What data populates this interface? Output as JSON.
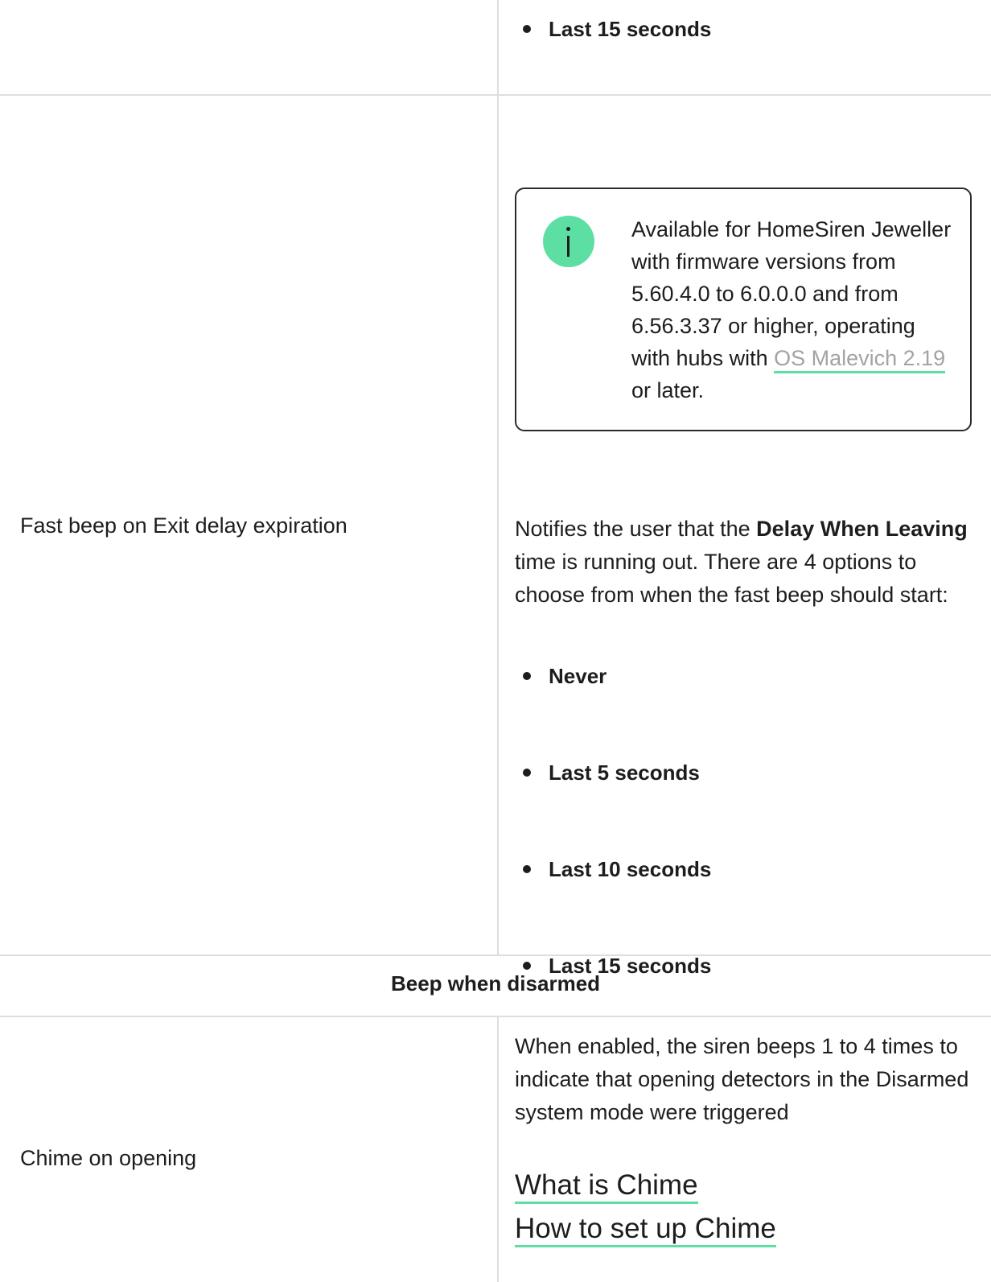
{
  "row_top": {
    "bullets": [
      "Last 15 seconds"
    ]
  },
  "row_fast_beep": {
    "label": "Fast beep on Exit delay expiration",
    "note": {
      "text_before_link": "Available for HomeSiren Jeweller with firmware versions from 5.60.4.0 to 6.0.0.0 and from 6.56.3.37 or higher, operating with hubs with ",
      "link_text": "OS Malevich 2.19",
      "text_after_link": " or later."
    },
    "description": {
      "part1": "Notifies the user that the ",
      "bold": "Delay When Leaving",
      "part2": " time is running out. There are 4 options to choose from when the fast beep should start:"
    },
    "options": [
      "Never",
      "Last 5 seconds",
      "Last 10 seconds",
      "Last 15 seconds"
    ]
  },
  "section": {
    "heading": "Beep when disarmed"
  },
  "row_chime": {
    "label": "Chime on opening",
    "description": "When enabled, the siren beeps 1 to 4 times to indicate that opening detectors in the Disarmed system mode were triggered",
    "links": [
      "What is Chime",
      "How to set up Chime"
    ]
  },
  "colors": {
    "accent": "#5ddfa4",
    "border": "#dedede",
    "text": "#1d1d1d",
    "link_muted": "#a3a3a3"
  }
}
